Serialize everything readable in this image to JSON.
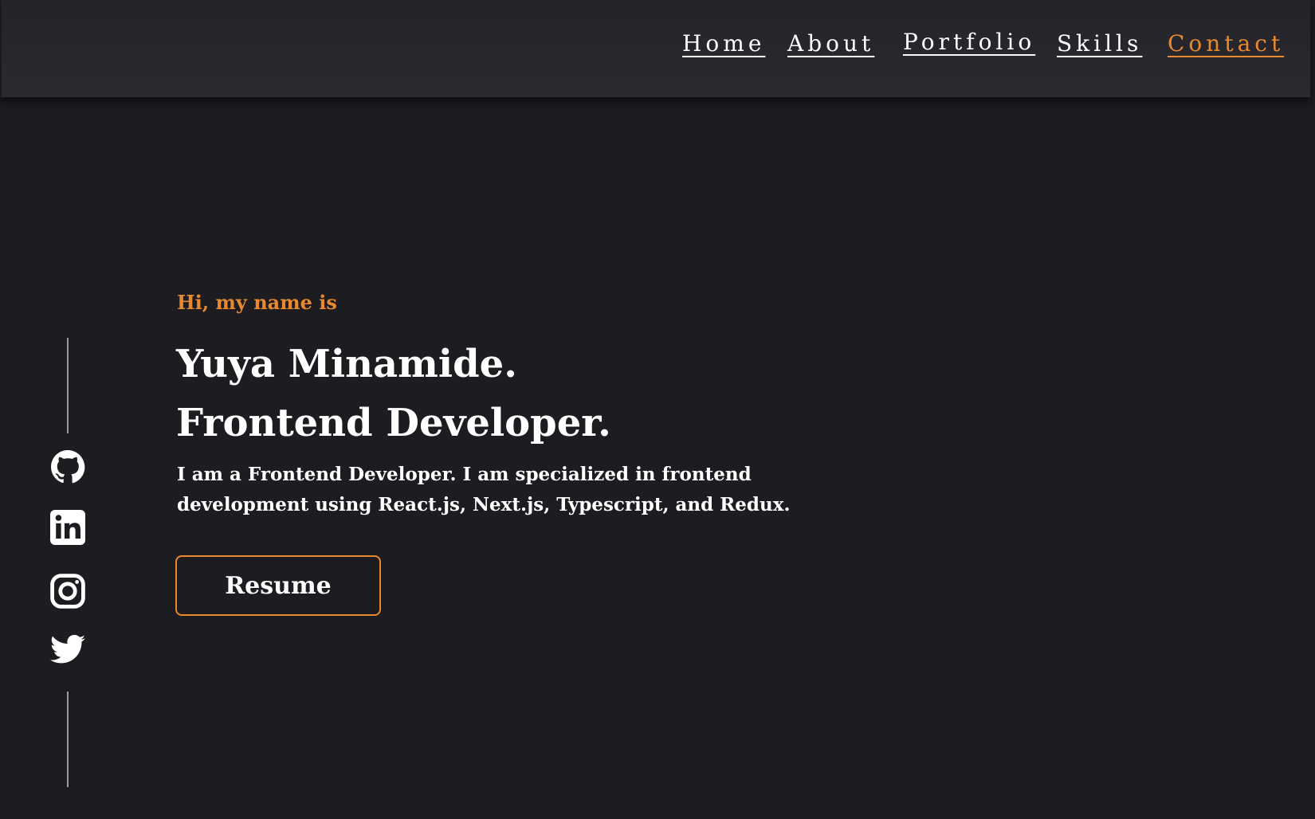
{
  "nav": {
    "items": [
      {
        "label": "Home",
        "active": false
      },
      {
        "label": "About",
        "active": false
      },
      {
        "label": "Portfolio",
        "active": false
      },
      {
        "label": "Skills",
        "active": false
      },
      {
        "label": "Contact",
        "active": true
      }
    ]
  },
  "hero": {
    "greeting": "Hi, my name is",
    "name": "Yuya Minamide.",
    "role": "Frontend Developer.",
    "description": "I am a Frontend Developer. I am specialized in frontend development using React.js, Next.js, Typescript, and Redux.",
    "resume_label": "Resume"
  },
  "social": {
    "icons": [
      "github-icon",
      "linkedin-icon",
      "instagram-icon",
      "twitter-icon"
    ]
  },
  "colors": {
    "background": "#1d1c21",
    "navbar": "#28272d",
    "accent": "#e8892f",
    "text": "#ffffff"
  }
}
